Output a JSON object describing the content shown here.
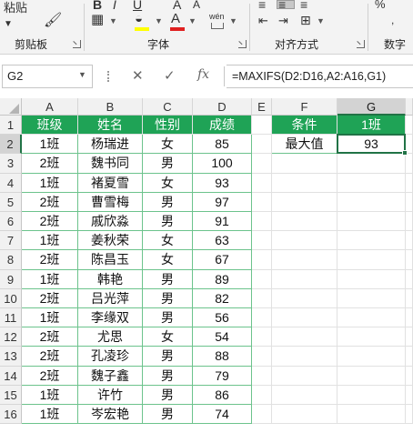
{
  "ribbon": {
    "clipboard_paste": "粘贴",
    "groups": {
      "clipboard": "剪贴板",
      "font": "字体",
      "alignment": "对齐方式",
      "number": "数字"
    },
    "font_buttons": {
      "bold": "B",
      "italic": "I",
      "underline": "U",
      "font_grow": "A",
      "font_shrink": "A",
      "font_color": "A",
      "phonetic": "wén"
    }
  },
  "formula_bar": {
    "name_box": "G2",
    "formula": "=MAXIFS(D2:D16,A2:A16,G1)",
    "fx_label": "fx"
  },
  "columns": [
    "A",
    "B",
    "C",
    "D",
    "E",
    "F",
    "G"
  ],
  "rows": [
    "1",
    "2",
    "3",
    "4",
    "5",
    "6",
    "7",
    "8",
    "9",
    "10",
    "11",
    "12",
    "13",
    "14",
    "15",
    "16"
  ],
  "table": {
    "headers": [
      "班级",
      "姓名",
      "性别",
      "成绩"
    ],
    "records": [
      [
        "1班",
        "杨瑞进",
        "女",
        "85"
      ],
      [
        "2班",
        "魏书同",
        "男",
        "100"
      ],
      [
        "1班",
        "褚夏雪",
        "女",
        "93"
      ],
      [
        "2班",
        "曹雪梅",
        "男",
        "97"
      ],
      [
        "2班",
        "戚欣淼",
        "男",
        "91"
      ],
      [
        "1班",
        "姜秋荣",
        "女",
        "63"
      ],
      [
        "2班",
        "陈昌玉",
        "女",
        "67"
      ],
      [
        "1班",
        "韩艳",
        "男",
        "89"
      ],
      [
        "2班",
        "吕光萍",
        "男",
        "82"
      ],
      [
        "1班",
        "李缘双",
        "男",
        "56"
      ],
      [
        "2班",
        "尤思",
        "女",
        "54"
      ],
      [
        "2班",
        "孔凌珍",
        "男",
        "88"
      ],
      [
        "2班",
        "魏子鑫",
        "男",
        "79"
      ],
      [
        "1班",
        "许竹",
        "男",
        "86"
      ],
      [
        "1班",
        "岑宏艳",
        "男",
        "74"
      ]
    ]
  },
  "criteria": {
    "label_header": "条件",
    "value_header": "1班",
    "row_label": "最大值",
    "result": "93"
  },
  "colors": {
    "header_green": "#1fa356",
    "selection_green": "#217346",
    "border_green": "#6cc38c"
  }
}
